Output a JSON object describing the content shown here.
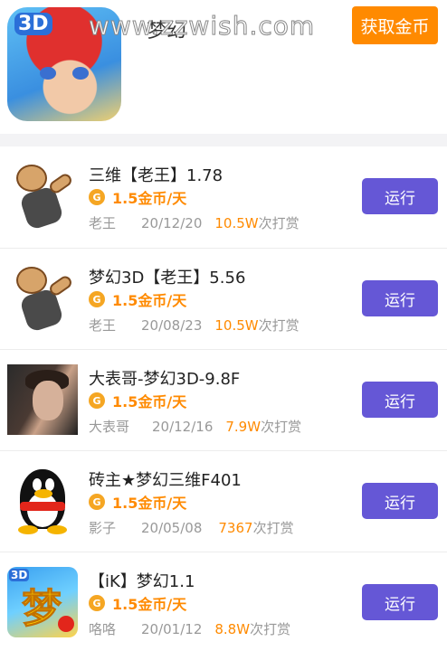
{
  "header": {
    "watermark": "www.zzwish.com",
    "title_obscured": "梦幻",
    "app_icon_badge": "3D",
    "coin_button_label": "获取金币"
  },
  "scripts": [
    {
      "name": "三维【老王】1.78",
      "coin_symbol": "G",
      "rate": "1.5金币/天",
      "author": "老王",
      "date": "20/12/20",
      "count": "10.5W",
      "suffix": "次打赏",
      "button": "运行",
      "avatar": "bear"
    },
    {
      "name": "梦幻3D【老王】5.56",
      "coin_symbol": "G",
      "rate": "1.5金币/天",
      "author": "老王",
      "date": "20/08/23",
      "count": "10.5W",
      "suffix": "次打赏",
      "button": "运行",
      "avatar": "bear"
    },
    {
      "name": "大表哥-梦幻3D-9.8F",
      "coin_symbol": "G",
      "rate": "1.5金币/天",
      "author": "大表哥",
      "date": "20/12/16",
      "count": "7.9W",
      "suffix": "次打赏",
      "button": "运行",
      "avatar": "photo"
    },
    {
      "name": "砖主★梦幻三维F401",
      "coin_symbol": "G",
      "rate": "1.5金币/天",
      "author": "影子",
      "date": "20/05/08",
      "count": "7367",
      "suffix": "次打赏",
      "button": "运行",
      "avatar": "qq"
    },
    {
      "name": "【iK】梦幻1.1",
      "coin_symbol": "G",
      "rate": "1.5金币/天",
      "author": "咯咯",
      "date": "20/01/12",
      "count": "8.8W",
      "suffix": "次打赏",
      "button": "运行",
      "avatar": "dream",
      "avatar_badge": "3D",
      "avatar_glyph": "梦"
    }
  ],
  "colors": {
    "accent_orange": "#ff8a00",
    "run_button": "#6557d6",
    "coin": "#f5a623"
  }
}
